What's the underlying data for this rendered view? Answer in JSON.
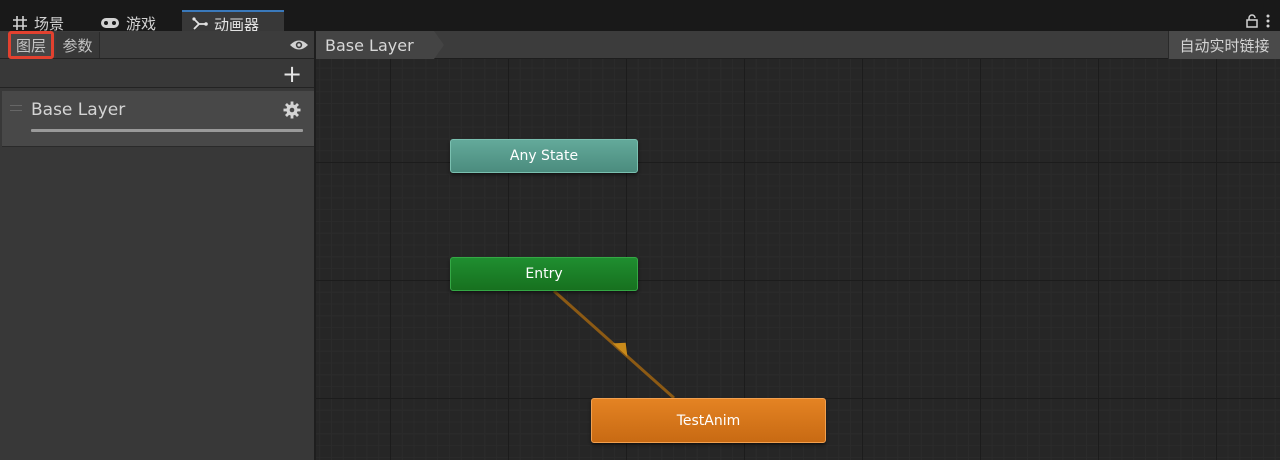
{
  "tabs": [
    {
      "label": "场景",
      "icon": "grid-icon"
    },
    {
      "label": "游戏",
      "icon": "gamepad-icon"
    },
    {
      "label": "动画器",
      "icon": "animator-icon",
      "active": true
    }
  ],
  "left_panel": {
    "layers_tab": "图层",
    "params_tab": "参数",
    "add_label": "+",
    "layers": [
      {
        "name": "Base Layer",
        "weight": 1.0
      }
    ]
  },
  "graph": {
    "breadcrumb": "Base Layer",
    "auto_live_link": "自动实时链接",
    "states": {
      "any_state": "Any State",
      "entry": "Entry",
      "test_anim": "TestAnim"
    }
  },
  "colors": {
    "accent_tab": "#3a79bb",
    "highlight_box": "#e2412f",
    "any_state": "#5ea193",
    "entry": "#1c8429",
    "default_state": "#d97818",
    "transition": "#8c5a14"
  }
}
